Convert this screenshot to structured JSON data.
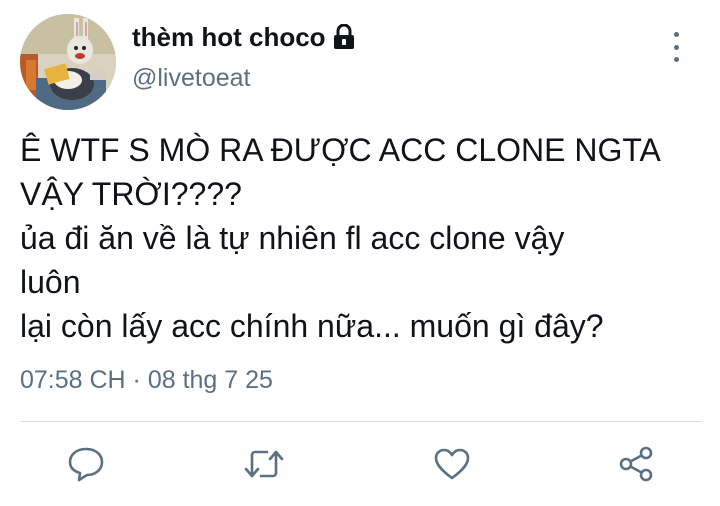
{
  "author": {
    "display_name": "thèm hot choco",
    "handle": "@livetoeat",
    "avatar": "cartoon-character-avatar",
    "protected_icon": "lock-icon"
  },
  "menu_icon": "more-vertical-icon",
  "tweet": {
    "lines": [
      "Ê WTF S MÒ RA ĐƯỢC ACC CLONE NGTA",
      "VẬY TRỜI????",
      "ủa đi ăn về là tự nhiên fl acc clone vậy",
      "luôn",
      "lại còn lấy acc chính nữa... muốn gì đây?"
    ],
    "timestamp": "07:58 CH · 08 thg 7 25"
  },
  "actions": [
    {
      "icon": "reply-icon"
    },
    {
      "icon": "retweet-icon"
    },
    {
      "icon": "like-icon"
    },
    {
      "icon": "share-icon"
    }
  ],
  "colors": {
    "text": "#0f1419",
    "secondary": "#5b7083",
    "divider": "#d9dee3",
    "icon": "#5b7083"
  }
}
